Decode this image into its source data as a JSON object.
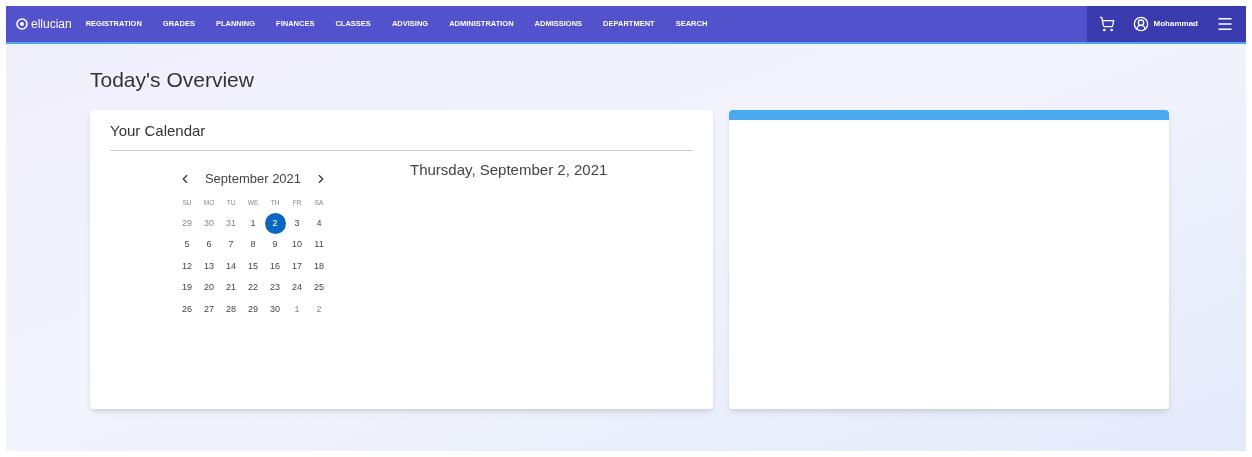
{
  "nav": {
    "logo": "ellucian",
    "items": [
      "REGISTRATION",
      "GRADES",
      "PLANNING",
      "FINANCES",
      "CLASSES",
      "ADVISING",
      "ADMINISTRATION",
      "ADMISSIONS",
      "DEPARTMENT",
      "SEARCH"
    ],
    "user": "Mohammad"
  },
  "page": {
    "title": "Today's Overview"
  },
  "calendar": {
    "title": "Your Calendar",
    "month": "September 2021",
    "selected_date": "Thursday, September 2, 2021",
    "weekdays": [
      "SU",
      "MO",
      "TU",
      "WE",
      "TH",
      "FR",
      "SA"
    ],
    "weeks": [
      [
        {
          "day": "29",
          "outside": true,
          "selected": false
        },
        {
          "day": "30",
          "outside": true,
          "selected": false
        },
        {
          "day": "31",
          "outside": true,
          "selected": false
        },
        {
          "day": "1",
          "outside": false,
          "selected": false
        },
        {
          "day": "2",
          "outside": false,
          "selected": true
        },
        {
          "day": "3",
          "outside": false,
          "selected": false
        },
        {
          "day": "4",
          "outside": false,
          "selected": false
        }
      ],
      [
        {
          "day": "5",
          "outside": false,
          "selected": false
        },
        {
          "day": "6",
          "outside": false,
          "selected": false
        },
        {
          "day": "7",
          "outside": false,
          "selected": false
        },
        {
          "day": "8",
          "outside": false,
          "selected": false
        },
        {
          "day": "9",
          "outside": false,
          "selected": false
        },
        {
          "day": "10",
          "outside": false,
          "selected": false
        },
        {
          "day": "11",
          "outside": false,
          "selected": false
        }
      ],
      [
        {
          "day": "12",
          "outside": false,
          "selected": false
        },
        {
          "day": "13",
          "outside": false,
          "selected": false
        },
        {
          "day": "14",
          "outside": false,
          "selected": false
        },
        {
          "day": "15",
          "outside": false,
          "selected": false
        },
        {
          "day": "16",
          "outside": false,
          "selected": false
        },
        {
          "day": "17",
          "outside": false,
          "selected": false
        },
        {
          "day": "18",
          "outside": false,
          "selected": false
        }
      ],
      [
        {
          "day": "19",
          "outside": false,
          "selected": false
        },
        {
          "day": "20",
          "outside": false,
          "selected": false
        },
        {
          "day": "21",
          "outside": false,
          "selected": false
        },
        {
          "day": "22",
          "outside": false,
          "selected": false
        },
        {
          "day": "23",
          "outside": false,
          "selected": false
        },
        {
          "day": "24",
          "outside": false,
          "selected": false
        },
        {
          "day": "25",
          "outside": false,
          "selected": false
        }
      ],
      [
        {
          "day": "26",
          "outside": false,
          "selected": false
        },
        {
          "day": "27",
          "outside": false,
          "selected": false
        },
        {
          "day": "28",
          "outside": false,
          "selected": false
        },
        {
          "day": "29",
          "outside": false,
          "selected": false
        },
        {
          "day": "30",
          "outside": false,
          "selected": false
        },
        {
          "day": "1",
          "outside": true,
          "selected": false
        },
        {
          "day": "2",
          "outside": true,
          "selected": false
        }
      ]
    ]
  }
}
